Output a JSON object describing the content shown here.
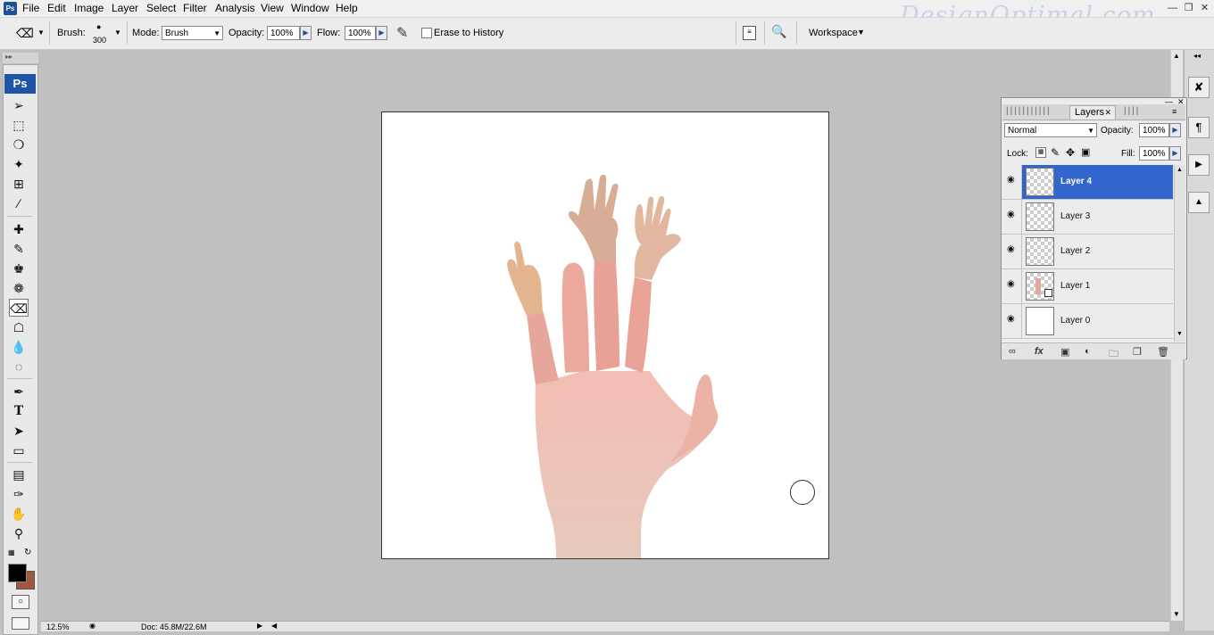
{
  "menubar": {
    "app_icon": "Ps",
    "items": [
      "File",
      "Edit",
      "Image",
      "Layer",
      "Select",
      "Filter",
      "Analysis",
      "View",
      "Window",
      "Help"
    ],
    "watermark": "DesignOptimal.com",
    "window_buttons": [
      "minimize-icon",
      "restore-icon",
      "close-icon"
    ]
  },
  "options": {
    "brush_label": "Brush:",
    "brush_size": "300",
    "mode_label": "Mode:",
    "mode_value": "Brush",
    "opacity_label": "Opacity:",
    "opacity_value": "100%",
    "flow_label": "Flow:",
    "flow_value": "100%",
    "erase_history_label": "Erase to History",
    "erase_history_checked": false,
    "workspace_label": "Workspace"
  },
  "toolbox": {
    "logo": "Ps",
    "tools": [
      "move-tool-icon",
      "marquee-tool-icon",
      "lasso-tool-icon",
      "magic-wand-icon",
      "crop-tool-icon",
      "slice-tool-icon",
      "healing-brush-icon",
      "brush-tool-icon",
      "clone-stamp-icon",
      "history-brush-icon",
      "eraser-tool-icon",
      "paint-bucket-icon",
      "blur-tool-icon",
      "dodge-tool-icon",
      "pen-tool-icon",
      "type-tool-icon",
      "path-selection-icon",
      "shape-tool-icon",
      "notes-tool-icon",
      "eyedropper-icon",
      "hand-tool-icon",
      "zoom-tool-icon"
    ],
    "active_tool": "eraser-tool-icon",
    "foreground_color": "#000000",
    "background_color": "#a0573d"
  },
  "status": {
    "zoom": "12.5%",
    "doc_info": "Doc: 45.8M/22.6M"
  },
  "layers_panel": {
    "tab_label": "Layers",
    "blend_mode": "Normal",
    "opacity_label": "Opacity:",
    "opacity_value": "100%",
    "lock_label": "Lock:",
    "fill_label": "Fill:",
    "fill_value": "100%",
    "layers": [
      {
        "name": "Layer 4",
        "selected": true,
        "visible": true
      },
      {
        "name": "Layer 3",
        "selected": false,
        "visible": true
      },
      {
        "name": "Layer 2",
        "selected": false,
        "visible": true
      },
      {
        "name": "Layer 1",
        "selected": false,
        "visible": true
      },
      {
        "name": "Layer 0",
        "selected": false,
        "visible": true
      }
    ]
  }
}
